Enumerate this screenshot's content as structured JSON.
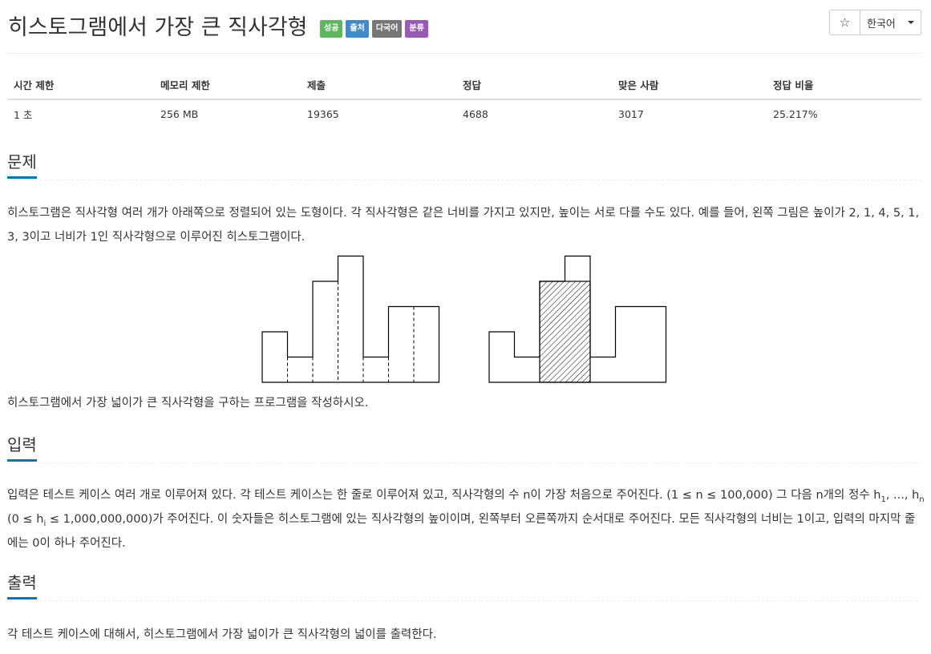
{
  "problem": {
    "title": "히스토그램에서 가장 큰 직사각형",
    "labels": {
      "success": "성공",
      "source": "출처",
      "multilang": "다국어",
      "tags": "분류"
    }
  },
  "toolbar": {
    "star_icon": "☆",
    "language": "한국어"
  },
  "stats": {
    "headers": [
      "시간 제한",
      "메모리 제한",
      "제출",
      "정답",
      "맞은 사람",
      "정답 비율"
    ],
    "values": [
      "1 초",
      "256 MB",
      "19365",
      "4688",
      "3017",
      "25.217%"
    ]
  },
  "sections": {
    "description": {
      "heading": "문제",
      "p1": "히스토그램은 직사각형 여러 개가 아래쪽으로 정렬되어 있는 도형이다. 각 직사각형은 같은 너비를 가지고 있지만, 높이는 서로 다를 수도 있다. 예를 들어, 왼쪽 그림은 높이가 2, 1, 4, 5, 1, 3, 3이고 너비가 1인 직사각형으로 이루어진 히스토그램이다.",
      "p2": "히스토그램에서 가장 넓이가 큰 직사각형을 구하는 프로그램을 작성하시오."
    },
    "input": {
      "heading": "입력",
      "t1": "입력은 테스트 케이스 여러 개로 이루어져 있다. 각 테스트 케이스는 한 줄로 이루어져 있고, 직사각형의 수 n이 가장 처음으로 주어진다. (1 ≤ n ≤ 100,000) 그 다음 n개의 정수 h",
      "s1": "1",
      "t2": ", ..., h",
      "s2": "n",
      "t3": " (0 ≤ h",
      "s3": "i",
      "t4": " ≤ 1,000,000,000)가 주어진다. 이 숫자들은 히스토그램에 있는 직사각형의 높이이며, 왼쪽부터 오른쪽까지 순서대로 주어진다. 모든 직사각형의 너비는 1이고, 입력의 마지막 줄에는 0이 하나 주어진다."
    },
    "output": {
      "heading": "출력",
      "p1": "각 테스트 케이스에 대해서, 히스토그램에서 가장 넓이가 큰 직사각형의 넓이를 출력한다."
    }
  },
  "histogram": {
    "heights": [
      2,
      1,
      4,
      5,
      1,
      3,
      3
    ],
    "largest_rectangle": {
      "start_index": 2,
      "end_index": 3,
      "height": 4
    }
  }
}
